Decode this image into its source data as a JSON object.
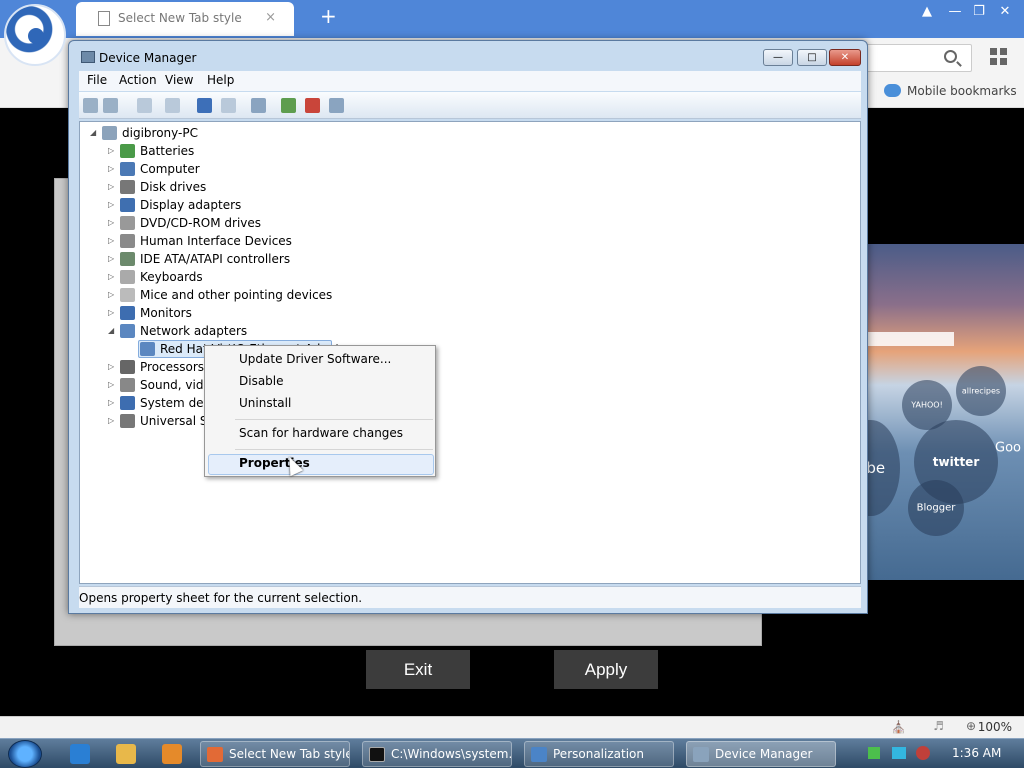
{
  "browser": {
    "tab_title": "Select New Tab style",
    "tab_close": "×",
    "new_tab": "+",
    "bookmarks_label": "Mobile bookmarks",
    "zoom": "100%"
  },
  "device_manager": {
    "title": "Device Manager",
    "menus": [
      "File",
      "Action",
      "View",
      "Help"
    ],
    "tree_root": "digibrony-PC",
    "categories": [
      "Batteries",
      "Computer",
      "Disk drives",
      "Display adapters",
      "DVD/CD-ROM drives",
      "Human Interface Devices",
      "IDE ATA/ATAPI controllers",
      "Keyboards",
      "Mice and other pointing devices",
      "Monitors",
      "Network adapters",
      "Processors",
      "Sound, video",
      "System devi",
      "Universal Se"
    ],
    "selected_device": "Red Hat VirtIO Ethernet Adapter",
    "status_text": "Opens property sheet for the current selection."
  },
  "context_menu": {
    "items": [
      "Update Driver Software...",
      "Disable",
      "Uninstall",
      "Scan for hardware changes",
      "Properties"
    ]
  },
  "dialog_buttons": {
    "exit": "Exit",
    "apply": "Apply"
  },
  "speed_dial": {
    "labels": [
      "allrecipes",
      "YAHOO!",
      "twitter",
      "ube",
      "Blogger",
      "Goo"
    ]
  },
  "taskbar": {
    "buttons": [
      "Select New Tab style ...",
      "C:\\Windows\\system...",
      "Personalization",
      "Device Manager"
    ],
    "clock": "1:36 AM"
  }
}
